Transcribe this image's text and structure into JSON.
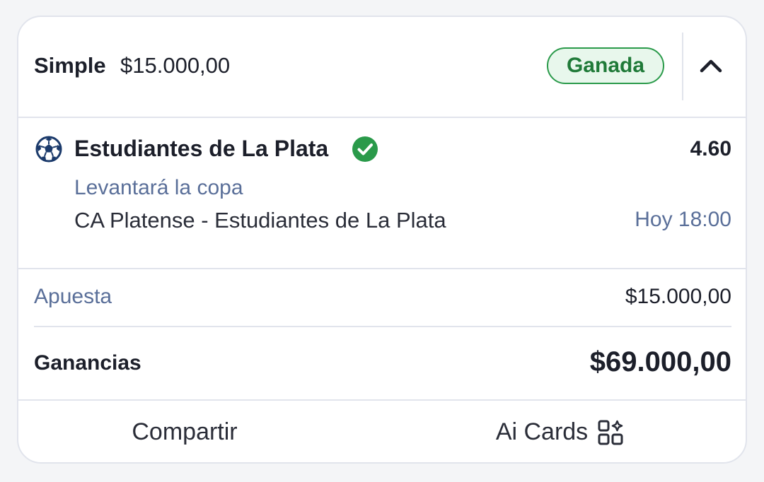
{
  "header": {
    "bet_type": "Simple",
    "bet_amount": "$15.000,00",
    "status": "Ganada",
    "collapse_icon": "chevron-up-icon"
  },
  "selection": {
    "sport_icon": "soccer-ball-icon",
    "team": "Estudiantes de La Plata",
    "result_icon": "check-circle-icon",
    "odds": "4.60",
    "market": "Levantará la copa",
    "event": "CA Platense - Estudiantes de La Plata",
    "time": "Hoy 18:00"
  },
  "summary": {
    "stake_label": "Apuesta",
    "stake_value": "$15.000,00",
    "winnings_label": "Ganancias",
    "winnings_value": "$69.000,00"
  },
  "footer": {
    "share_label": "Compartir",
    "ai_cards_label": "Ai Cards",
    "ai_cards_icon": "grid-sparkle-icon"
  },
  "colors": {
    "win_green": "#2a9a4a",
    "muted_blue": "#5a6f99",
    "text_dark": "#1c1f2a",
    "border": "#e1e4ec"
  }
}
